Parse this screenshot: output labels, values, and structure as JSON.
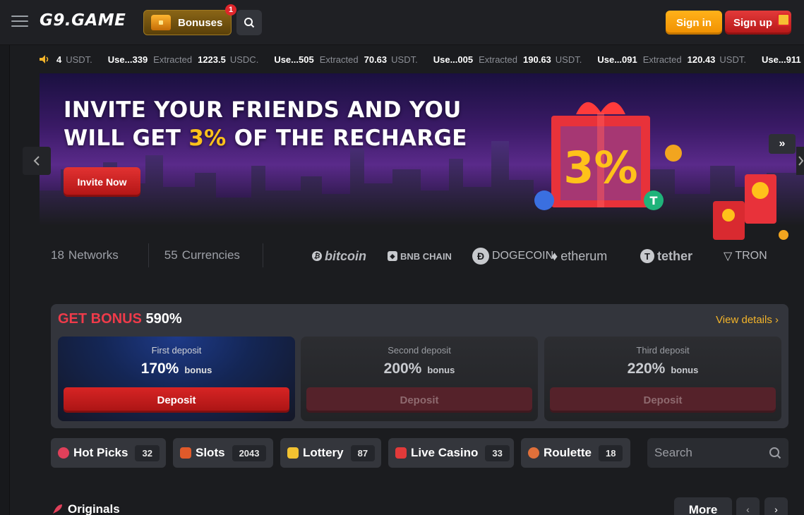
{
  "header": {
    "logo_text": "G9.GAME",
    "bonuses_label": "Bonuses",
    "bonuses_badge": "1",
    "signin_label": "Sign in",
    "signup_label": "Sign up"
  },
  "ticker": {
    "items": [
      {
        "user": "",
        "word": "",
        "amount": "4",
        "currency": "USDT."
      },
      {
        "user": "Use...339",
        "word": "Extracted",
        "amount": "1223.5",
        "currency": "USDC."
      },
      {
        "user": "Use...505",
        "word": "Extracted",
        "amount": "70.63",
        "currency": "USDT."
      },
      {
        "user": "Use...005",
        "word": "Extracted",
        "amount": "190.63",
        "currency": "USDT."
      },
      {
        "user": "Use...091",
        "word": "Extracted",
        "amount": "120.43",
        "currency": "USDT."
      },
      {
        "user": "Use...911",
        "word": "",
        "amount": "",
        "currency": ""
      }
    ]
  },
  "banner": {
    "line1": "INVITE YOUR FRIENDS AND YOU",
    "line2_pre": "WILL GET ",
    "line2_hl": "3%",
    "line2_post": " OF THE RECHARGE",
    "cta": "Invite Now",
    "gift_text": "3%",
    "ff_label": "»"
  },
  "stats": {
    "networks_num": "18",
    "networks_label": "Networks",
    "currencies_num": "55",
    "currencies_label": "Currencies"
  },
  "coins": [
    {
      "name": "bitcoin",
      "icon": "bitcoin-icon"
    },
    {
      "name": "BNB CHAIN",
      "icon": "bnb-icon"
    },
    {
      "name": "DOGECOIN",
      "icon": "dogecoin-icon"
    },
    {
      "name": "etherum",
      "icon": "ethereum-icon"
    },
    {
      "name": "tether",
      "icon": "tether-icon"
    },
    {
      "name": "TRON",
      "icon": "tron-icon"
    }
  ],
  "bonus": {
    "title_red": "GET BONUS",
    "title_white": "590%",
    "view_details": "View details ›",
    "cards": [
      {
        "label": "First deposit",
        "pct": "170%",
        "suffix": "bonus",
        "btn": "Deposit"
      },
      {
        "label": "Second deposit",
        "pct": "200%",
        "suffix": "bonus",
        "btn": "Deposit"
      },
      {
        "label": "Third deposit",
        "pct": "220%",
        "suffix": "bonus",
        "btn": "Deposit"
      }
    ]
  },
  "categories": [
    {
      "name": "Hot Picks",
      "count": "32",
      "color": "#e0405a"
    },
    {
      "name": "Slots",
      "count": "2043",
      "color": "#e05a2a"
    },
    {
      "name": "Lottery",
      "count": "87",
      "color": "#f2c231"
    },
    {
      "name": "Live Casino",
      "count": "33",
      "color": "#e23a3a"
    },
    {
      "name": "Roulette",
      "count": "18",
      "color": "#e0703a"
    }
  ],
  "search": {
    "placeholder": "Search"
  },
  "section": {
    "originals": "Originals",
    "more": "More"
  },
  "colors": {
    "accent_gold": "#f3b42a",
    "accent_red": "#e0262b",
    "bonus_red": "#ef3b4a"
  }
}
